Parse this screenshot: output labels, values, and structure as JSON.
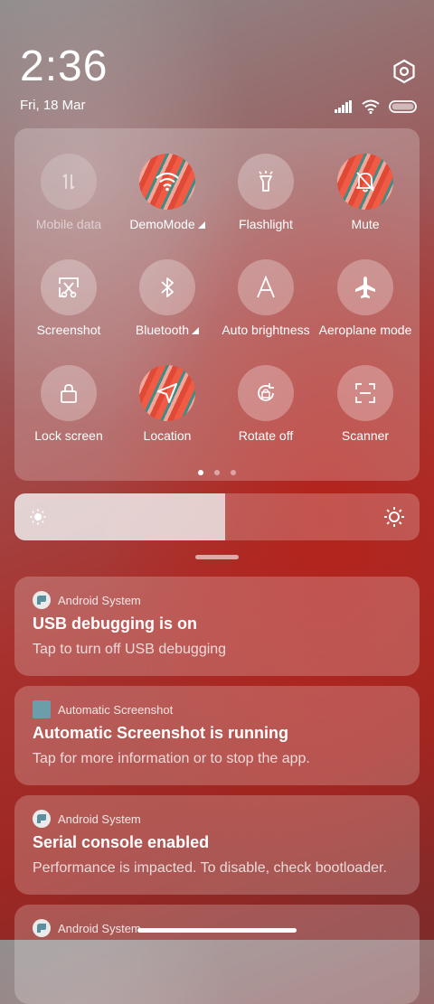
{
  "status": {
    "time": "2:36",
    "date": "Fri, 18 Mar"
  },
  "quick_settings": {
    "tiles": [
      {
        "label": "Mobile data",
        "icon": "mobile-data-icon",
        "state": "disabled"
      },
      {
        "label": "DemoMode",
        "icon": "wifi-icon",
        "state": "active"
      },
      {
        "label": "Flashlight",
        "icon": "flashlight-icon",
        "state": "off"
      },
      {
        "label": "Mute",
        "icon": "bell-off-icon",
        "state": "active"
      },
      {
        "label": "Screenshot",
        "icon": "screenshot-icon",
        "state": "off"
      },
      {
        "label": "Bluetooth",
        "icon": "bluetooth-icon",
        "state": "off"
      },
      {
        "label": "Auto brightness",
        "icon": "auto-brightness-icon",
        "state": "off"
      },
      {
        "label": "Aeroplane mode",
        "icon": "airplane-icon",
        "state": "off"
      },
      {
        "label": "Lock screen",
        "icon": "lock-icon",
        "state": "off"
      },
      {
        "label": "Location",
        "icon": "location-icon",
        "state": "active"
      },
      {
        "label": "Rotate off",
        "icon": "rotate-lock-icon",
        "state": "off"
      },
      {
        "label": "Scanner",
        "icon": "scanner-icon",
        "state": "off"
      }
    ],
    "page_indicator": {
      "pages": 3,
      "current": 1
    }
  },
  "brightness": {
    "level_percent": 52
  },
  "notifications": [
    {
      "app": "Android System",
      "title": "USB debugging is on",
      "body": "Tap to turn off USB debugging"
    },
    {
      "app": "Automatic Screenshot",
      "title": "Automatic Screenshot is running",
      "body": "Tap for more information or to stop the app."
    },
    {
      "app": "Android System",
      "title": "Serial console enabled",
      "body": "Performance is impacted. To disable, check bootloader."
    },
    {
      "app": "Android System",
      "title": "",
      "body": ""
    }
  ],
  "colors": {
    "accent_active": "#ef5b45",
    "panel_bg": "rgba(255,255,255,0.22)"
  }
}
